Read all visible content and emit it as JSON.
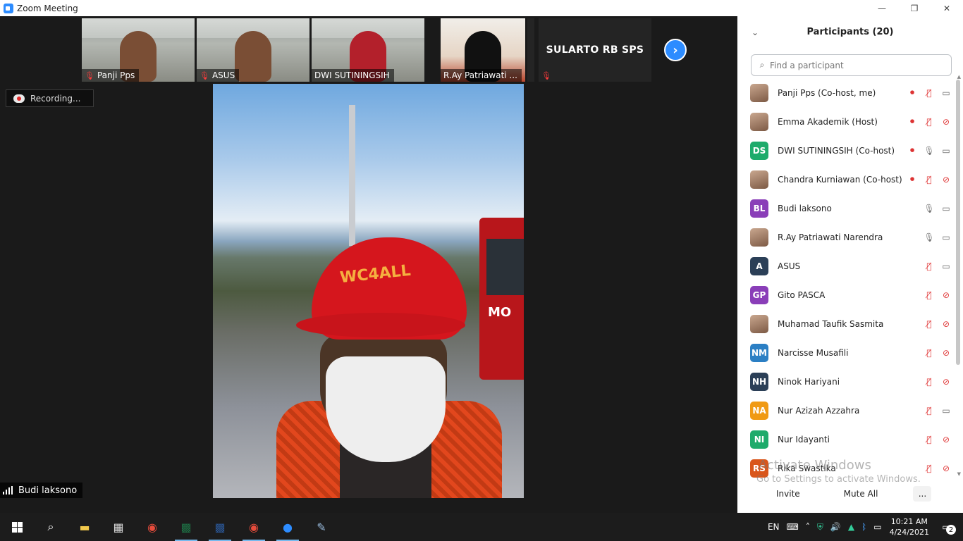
{
  "window": {
    "title": "Zoom Meeting",
    "minimize": "—",
    "restore": "❐",
    "close": "✕"
  },
  "gallery": {
    "tiles": [
      {
        "name": "Panji Pps"
      },
      {
        "name": "ASUS"
      },
      {
        "name": "DWI SUTININGSIH"
      },
      {
        "name": "R.Ay Patriawati ..."
      },
      {
        "name": "SULARTO RB SPS"
      }
    ],
    "next_label": "›"
  },
  "recording": {
    "label": "Recording..."
  },
  "speaker": {
    "name": "Budi laksono"
  },
  "main_video": {
    "cap_text": "WC4ALL",
    "truck_text": "MO"
  },
  "participants": {
    "title": "Participants (20)",
    "search_placeholder": "Find a participant",
    "items": [
      {
        "initials": "",
        "color": "",
        "name": "Panji Pps (Co-host, me)",
        "rec": true,
        "mic": "off",
        "cam": "on"
      },
      {
        "initials": "",
        "color": "",
        "name": "Emma Akademik (Host)",
        "rec": true,
        "mic": "off",
        "cam": "off"
      },
      {
        "initials": "DS",
        "color": "#1eab6b",
        "name": "DWI SUTININGSIH (Co-host)",
        "rec": true,
        "mic": "on",
        "cam": "on"
      },
      {
        "initials": "",
        "color": "",
        "name": "Chandra Kurniawan (Co-host)",
        "rec": true,
        "mic": "off",
        "cam": "off"
      },
      {
        "initials": "BL",
        "color": "#8a3eb8",
        "name": "Budi laksono",
        "rec": false,
        "mic": "on",
        "cam": "on"
      },
      {
        "initials": "",
        "color": "",
        "name": "R.Ay Patriawati Narendra",
        "rec": false,
        "mic": "on",
        "cam": "on"
      },
      {
        "initials": "A",
        "color": "#2b3f57",
        "name": "ASUS",
        "rec": false,
        "mic": "off",
        "cam": "on"
      },
      {
        "initials": "GP",
        "color": "#8a3eb8",
        "name": "Gito PASCA",
        "rec": false,
        "mic": "off",
        "cam": "off"
      },
      {
        "initials": "",
        "color": "",
        "name": "Muhamad Taufik Sasmita",
        "rec": false,
        "mic": "off",
        "cam": "off"
      },
      {
        "initials": "NM",
        "color": "#2b7fc4",
        "name": "Narcisse Musafili",
        "rec": false,
        "mic": "off",
        "cam": "off"
      },
      {
        "initials": "NH",
        "color": "#2b3f57",
        "name": "Ninok Hariyani",
        "rec": false,
        "mic": "off",
        "cam": "off"
      },
      {
        "initials": "NA",
        "color": "#f09a14",
        "name": "Nur Azizah Azzahra",
        "rec": false,
        "mic": "off",
        "cam": "on"
      },
      {
        "initials": "NI",
        "color": "#1eab6b",
        "name": "Nur Idayanti",
        "rec": false,
        "mic": "off",
        "cam": "off"
      },
      {
        "initials": "RS",
        "color": "#d9561b",
        "name": "Rika Swastika",
        "rec": false,
        "mic": "off",
        "cam": "off"
      }
    ],
    "invite_label": "Invite",
    "mute_all_label": "Mute All",
    "more_label": "..."
  },
  "watermark": {
    "line1": "Activate Windows",
    "line2": "Go to Settings to activate Windows."
  },
  "taskbar": {
    "language": "EN",
    "time": "10:21 AM",
    "date": "4/24/2021",
    "notifications": "2"
  }
}
